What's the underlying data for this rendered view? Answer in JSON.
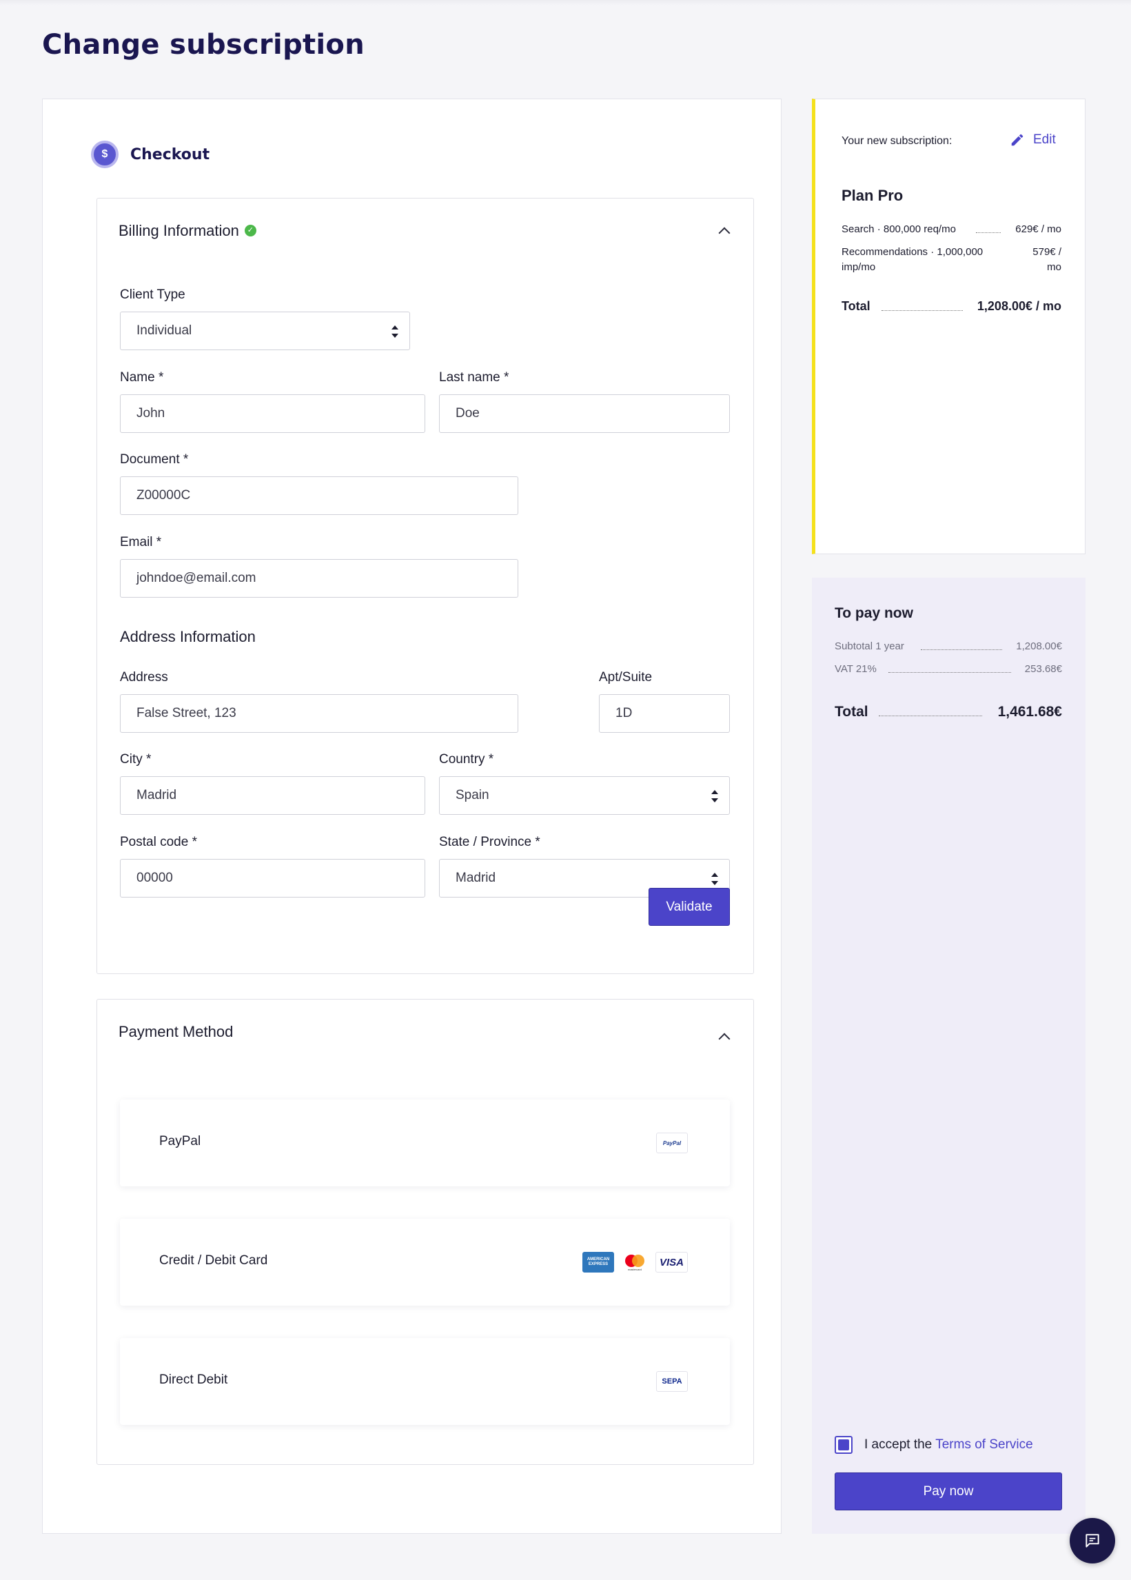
{
  "page": {
    "title": "Change subscription"
  },
  "checkout": {
    "title": "Checkout",
    "icon": "dollar-icon"
  },
  "billing": {
    "title": "Billing Information",
    "client_type": {
      "label": "Client Type",
      "value": "Individual"
    },
    "name": {
      "label": "Name *",
      "value": "John"
    },
    "last_name": {
      "label": "Last name *",
      "value": "Doe"
    },
    "document": {
      "label": "Document *",
      "value": "Z00000C"
    },
    "email": {
      "label": "Email *",
      "value": "johndoe@email.com"
    },
    "address_section": "Address Information",
    "address": {
      "label": "Address",
      "value": "False Street, 123"
    },
    "apt": {
      "label": "Apt/Suite",
      "value": "1D"
    },
    "city": {
      "label": "City *",
      "value": "Madrid"
    },
    "country": {
      "label": "Country *",
      "value": "Spain"
    },
    "postal": {
      "label": "Postal code *",
      "value": "00000"
    },
    "state": {
      "label": "State / Province *",
      "value": "Madrid"
    },
    "validate_label": "Validate"
  },
  "payment": {
    "title": "Payment Method",
    "options": [
      {
        "label": "PayPal",
        "badges": [
          "PayPal"
        ]
      },
      {
        "label": "Credit / Debit Card",
        "badges": [
          "AMERICAN EXPRESS",
          "mastercard",
          "VISA"
        ]
      },
      {
        "label": "Direct Debit",
        "badges": [
          "SEPA"
        ]
      }
    ]
  },
  "subscription": {
    "heading": "Your new subscription:",
    "edit_label": "Edit",
    "plan": "Plan Pro",
    "lines": [
      {
        "name": "Search · 800,000 req/mo",
        "price": "629€ / mo"
      },
      {
        "name_line1": "Recommendations · 1,000,000",
        "name_line2": "imp/mo",
        "price_line1": "579€ /",
        "price_line2": "mo"
      }
    ],
    "total_label": "Total",
    "total_value": "1,208.00€ / mo"
  },
  "pay_now": {
    "title": "To pay now",
    "subtotal_label": "Subtotal 1 year",
    "subtotal_value": "1,208.00€",
    "vat_label": "VAT 21%",
    "vat_value": "253.68€",
    "total_label": "Total",
    "total_value": "1,461.68€",
    "tos_prefix": "I accept the",
    "tos_link": "Terms of Service",
    "button_label": "Pay now"
  },
  "colors": {
    "accent": "#4b44c9",
    "title": "#1a1650",
    "highlight": "#f5e11c",
    "success": "#4cb84a",
    "panel": "#efedf8"
  }
}
